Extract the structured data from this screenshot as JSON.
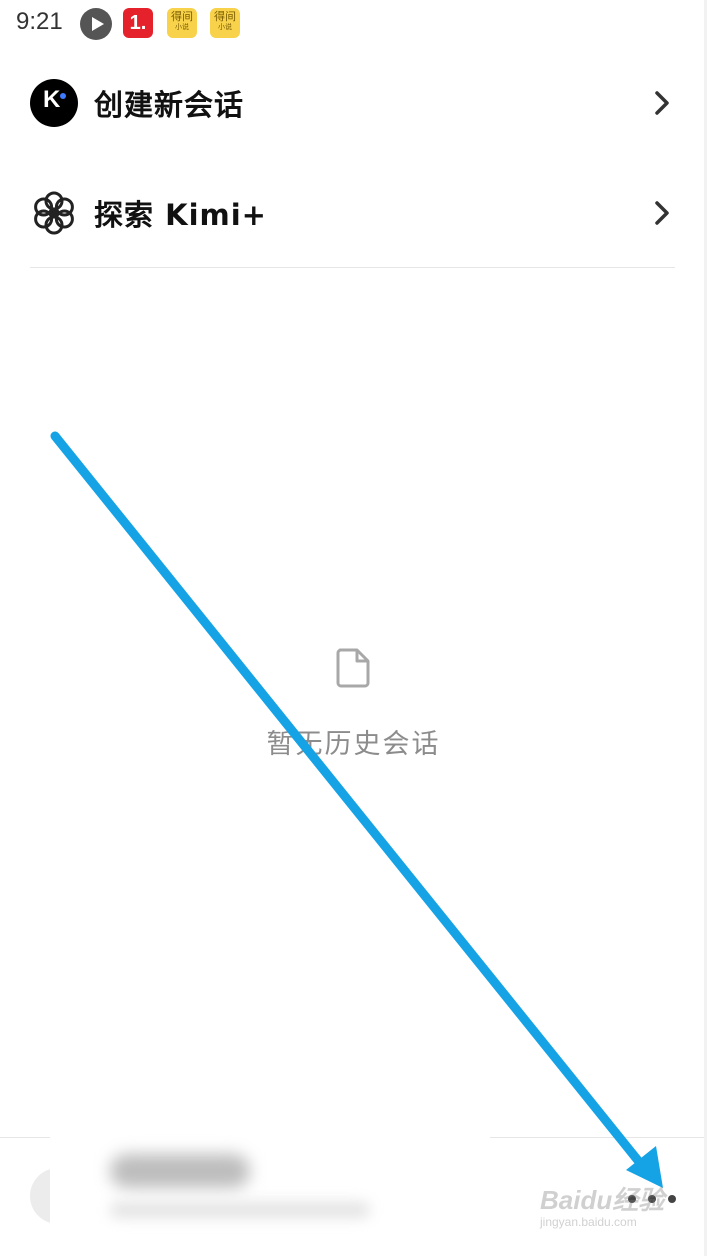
{
  "status_bar": {
    "time": "9:21",
    "icons": [
      "play-icon",
      "app-1-icon",
      "novel-app-icon",
      "novel-app-icon"
    ],
    "app_1_label": "1.",
    "novel_app_title": "得间",
    "novel_app_sub": "小说"
  },
  "menu": {
    "new_chat": {
      "label": "创建新会话",
      "icon": "kimi-logo-icon"
    },
    "explore": {
      "label": "探索 Kimi+",
      "icon": "flower-icon"
    }
  },
  "empty_state": {
    "icon": "document-icon",
    "text": "暂无历史会话"
  },
  "bottom_bar": {
    "more_icon": "more-dots-icon"
  },
  "watermark": {
    "main": "Baidu经验",
    "sub": "jingyan.baidu.com"
  },
  "colors": {
    "annotation_arrow": "#16a3e6",
    "empty_text": "#8c8c8c",
    "divider": "#e6e6e6"
  }
}
